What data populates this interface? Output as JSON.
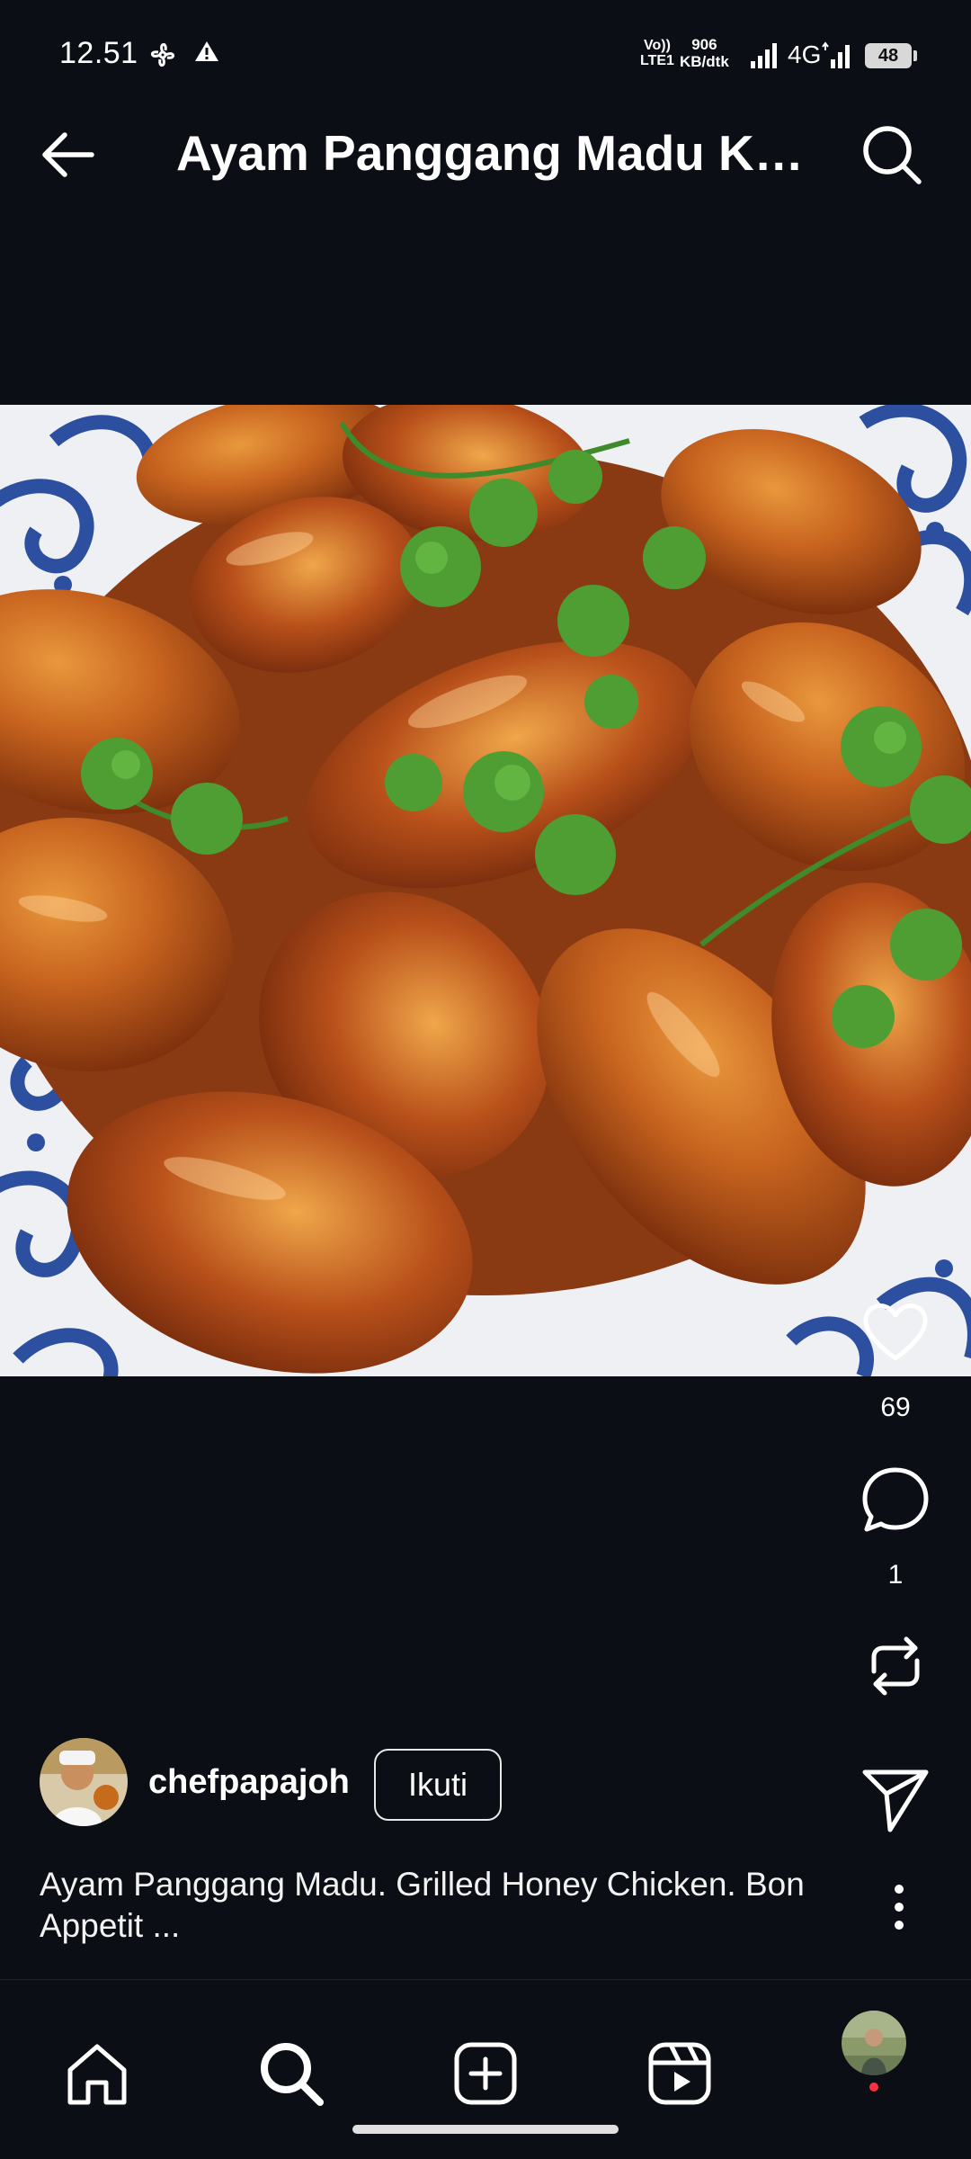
{
  "status_bar": {
    "time": "12.51",
    "network_line1": "Vo))",
    "network_line2": "LTE1",
    "speed_value": "906",
    "speed_unit": "KB/dtk",
    "network_type": "4G",
    "battery": "48"
  },
  "header": {
    "title": "Ayam Panggang Madu Ketchup"
  },
  "post": {
    "image_alt": "Grilled honey chicken wings with cilantro on a blue patterned plate",
    "likes": "69",
    "comments": "1",
    "author": "chefpapajoh",
    "follow_label": "Ikuti",
    "caption": "Ayam Panggang Madu. Grilled Honey Chicken. Bon Appetit ..."
  },
  "icons": {
    "back": "arrow-left",
    "search": "search",
    "like": "heart",
    "comment": "speech-bubble",
    "remix": "repost",
    "share": "paper-plane",
    "more": "vertical-dots",
    "nav": [
      "home",
      "search",
      "create",
      "reels",
      "profile"
    ]
  },
  "colors": {
    "background": "#0b0e14",
    "text": "#ffffff",
    "notification": "#ff3040"
  }
}
